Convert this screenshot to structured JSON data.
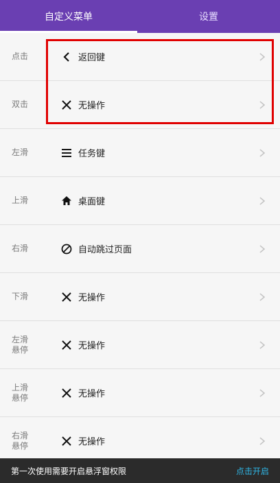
{
  "tabs": {
    "left_label": "自定义菜单",
    "right_label": "设置"
  },
  "rows": [
    {
      "gesture": [
        "点击"
      ],
      "action": "返回键",
      "icon": "back-chevron-icon"
    },
    {
      "gesture": [
        "双击"
      ],
      "action": "无操作",
      "icon": "close-icon"
    },
    {
      "gesture": [
        "左滑"
      ],
      "action": "任务键",
      "icon": "menu-icon"
    },
    {
      "gesture": [
        "上滑"
      ],
      "action": "桌面键",
      "icon": "home-icon"
    },
    {
      "gesture": [
        "右滑"
      ],
      "action": "自动跳过页面",
      "icon": "block-icon"
    },
    {
      "gesture": [
        "下滑"
      ],
      "action": "无操作",
      "icon": "close-icon"
    },
    {
      "gesture": [
        "左滑",
        "悬停"
      ],
      "action": "无操作",
      "icon": "close-icon"
    },
    {
      "gesture": [
        "上滑",
        "悬停"
      ],
      "action": "无操作",
      "icon": "close-icon"
    },
    {
      "gesture": [
        "右滑",
        "悬停"
      ],
      "action": "无操作",
      "icon": "close-icon"
    }
  ],
  "footer": {
    "message": "第一次使用需要开启悬浮窗权限",
    "cta": "点击开启"
  },
  "colors": {
    "tabbar": "#6a3fb2",
    "highlight": "#e00000",
    "cta": "#2fb6e6"
  }
}
